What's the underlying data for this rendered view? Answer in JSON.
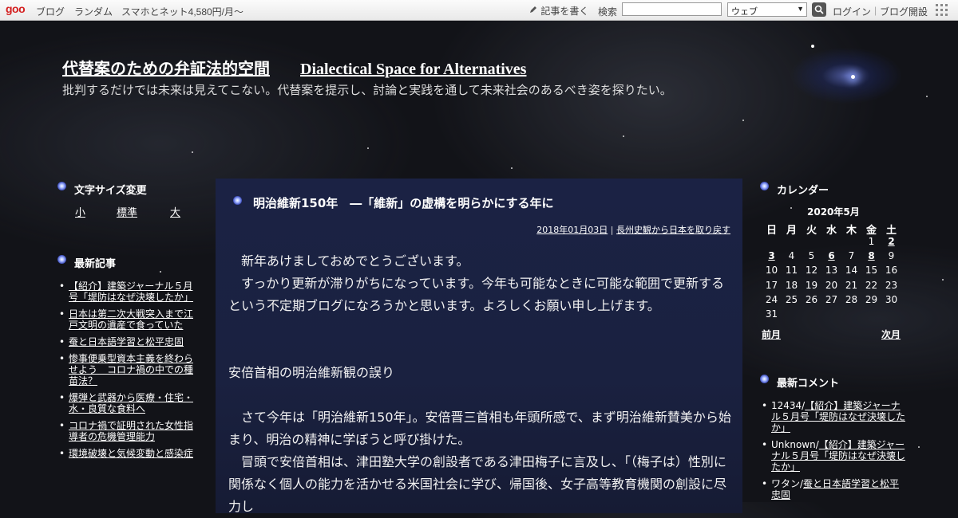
{
  "topbar": {
    "logo": "goo",
    "links": [
      "ブログ",
      "ランダム",
      "スマホとネット4,580円/月～"
    ],
    "write_label": "記事を書く",
    "search_label": "検索",
    "search_placeholder": "",
    "scope_value": "ウェブ",
    "login_label": "ログイン",
    "open_blog_label": "ブログ開設"
  },
  "header": {
    "title_ja": "代替案のための弁証法的空間",
    "title_en": "Dialectical Space for Alternatives",
    "description": "批判するだけでは未来は見えてこない。代替案を提示し、討論と実践を通して未来社会のあるべき姿を探りたい。"
  },
  "left": {
    "font_size_heading": "文字サイズ変更",
    "font_sizes": [
      "小",
      "標準",
      "大"
    ],
    "recent_heading": "最新記事",
    "recent_items": [
      "【紹介】建築ジャーナル５月号「堤防はなぜ決壊したか」",
      "日本は第二次大戦突入まで江戸文明の遺産で食っていた",
      "蚕と日本語学習と松平忠固",
      "惨事便乗型資本主義を終わらせよう　コロナ禍の中での種苗法？",
      "爆弾と武器から医療・住宅・水・良質な食料へ",
      "コロナ禍で証明された女性指導者の危機管理能力",
      "環境破壊と気候変動と感染症"
    ]
  },
  "article": {
    "title": "明治維新150年　―「維新」の虚構を明らかにする年に",
    "date": "2018年01月03日",
    "meta_sep": "|",
    "category": "長州史観から日本を取り戻す",
    "paragraphs": [
      "　新年あけましておめでとうございます。",
      "　すっかり更新が滞りがちになっています。今年も可能なときに可能な範囲で更新するという不定期ブログになろうかと思います。よろしくお願い申し上げます。",
      "",
      "",
      "安倍首相の明治維新観の誤り",
      "",
      "　さて今年は「明治維新150年」。安倍晋三首相も年頭所感で、まず明治維新賛美から始まり、明治の精神に学ぼうと呼び掛けた。",
      "　冒頭で安倍首相は、津田塾大学の創設者である津田梅子に言及し、「（梅子は）性別に関係なく個人の能力を活かせる米国社会に学び、帰国後、女子高等教育機関の創設に尽力し"
    ]
  },
  "calendar": {
    "heading": "カレンダー",
    "month": "2020年5月",
    "weekdays": [
      "日",
      "月",
      "火",
      "水",
      "木",
      "金",
      "土"
    ],
    "weeks": [
      [
        "",
        "",
        "",
        "",
        "",
        "1",
        "2"
      ],
      [
        "3",
        "4",
        "5",
        "6",
        "7",
        "8",
        "9"
      ],
      [
        "10",
        "11",
        "12",
        "13",
        "14",
        "15",
        "16"
      ],
      [
        "17",
        "18",
        "19",
        "20",
        "21",
        "22",
        "23"
      ],
      [
        "24",
        "25",
        "26",
        "27",
        "28",
        "29",
        "30"
      ],
      [
        "31",
        "",
        "",
        "",
        "",
        "",
        ""
      ]
    ],
    "linked_days": [
      "2",
      "3",
      "6",
      "8"
    ],
    "prev_label": "前月",
    "next_label": "次月"
  },
  "comments": {
    "heading": "最新コメント",
    "items": [
      {
        "author": "12434/",
        "target": "【紹介】建築ジャーナル５月号「堤防はなぜ決壊したか」"
      },
      {
        "author": "Unknown/",
        "target": "【紹介】建築ジャーナル５月号「堤防はなぜ決壊したか」"
      },
      {
        "author": "ワタン/",
        "target": "蚕と日本語学習と松平忠固"
      }
    ]
  }
}
